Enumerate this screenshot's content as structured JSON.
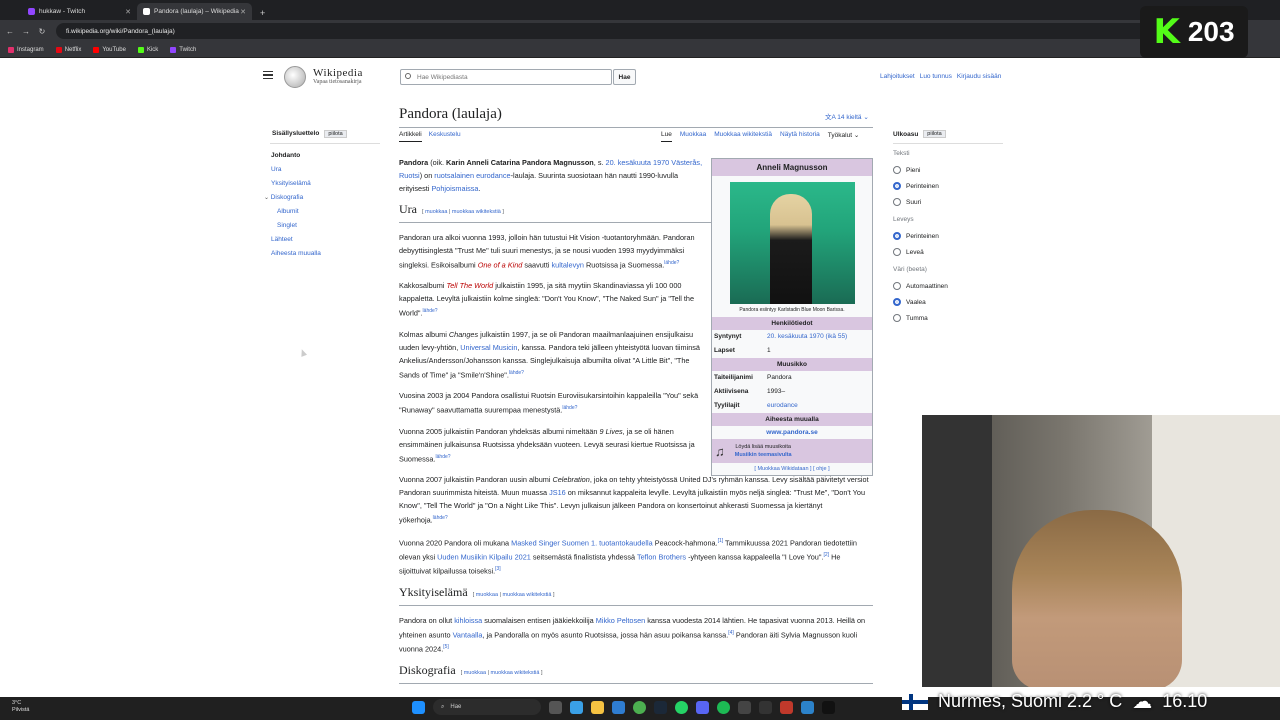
{
  "browser": {
    "tabs": [
      {
        "title": "hukkaw - Twitch",
        "active": false
      },
      {
        "title": "Pandora (laulaja) – Wikipedia",
        "active": true
      }
    ],
    "url": "fi.wikipedia.org/wiki/Pandora_(laulaja)",
    "bookmarks": [
      "Instagram",
      "Netflix",
      "YouTube",
      "Kick",
      "Twitch"
    ]
  },
  "wiki": {
    "wordmark": "Wikipedia",
    "tagline": "Vapaa tietosanakirja",
    "search_placeholder": "Hae Wikipediasta",
    "search_button": "Hae",
    "user_links": [
      "Lahjoitukset",
      "Luo tunnus",
      "Kirjaudu sisään"
    ],
    "title": "Pandora (laulaja)",
    "languages": "14 kieltä",
    "tabs_left": [
      "Artikkeli",
      "Keskustelu"
    ],
    "tabs_right": [
      "Lue",
      "Muokkaa",
      "Muokkaa wikitekstiä",
      "Näytä historia",
      "Työkalut"
    ]
  },
  "toc": {
    "title": "Sisällysluettelo",
    "hide": "piilota",
    "items": [
      {
        "label": "Johdanto",
        "level": 0,
        "selected": true
      },
      {
        "label": "Ura",
        "level": 0
      },
      {
        "label": "Yksityiselämä",
        "level": 0
      },
      {
        "label": "Diskografia",
        "level": 0
      },
      {
        "label": "Albumit",
        "level": 1
      },
      {
        "label": "Singlet",
        "level": 1
      },
      {
        "label": "Lähteet",
        "level": 0
      },
      {
        "label": "Aiheesta muualla",
        "level": 0
      }
    ]
  },
  "appearance": {
    "title": "Ulkoasu",
    "hide": "piilota",
    "text_label": "Teksti",
    "text_options": [
      {
        "label": "Pieni",
        "on": false
      },
      {
        "label": "Perinteinen",
        "on": true
      },
      {
        "label": "Suuri",
        "on": false
      }
    ],
    "width_label": "Leveys",
    "width_options": [
      {
        "label": "Perinteinen",
        "on": true
      },
      {
        "label": "Leveä",
        "on": false
      }
    ],
    "color_label": "Väri (beeta)",
    "color_options": [
      {
        "label": "Automaattinen",
        "on": false
      },
      {
        "label": "Vaalea",
        "on": true
      },
      {
        "label": "Tumma",
        "on": false
      }
    ]
  },
  "content": {
    "lead": {
      "name": "Pandora",
      "a": " (oik. ",
      "fullname": "Karin Anneli Catarina Pandora Magnusson",
      "b": ", s. ",
      "date": "20. kesäkuuta 1970",
      "place": "Västerås, Ruotsi",
      "c": ") on ",
      "genre": "ruotsalainen eurodance",
      "d": "-laulaja. Suurinta suosiotaan hän nautti 1990-luvulla erityisesti ",
      "region": "Pohjoismaissa",
      "e": "."
    },
    "edit": "muokkaa",
    "edit_wiki": "muokkaa wikitekstiä",
    "h_ura": "Ura",
    "ura_p1": "Pandoran ura alkoi vuonna 1993, jolloin hän tutustui Hit Vision -tuotantoryhmään. Pandoran debyyttisinglestä \"Trust Me\" tuli suuri menestys, ja se nousi vuoden 1993 myydyimmäksi singleksi. Esikoisalbumi ",
    "ura_p1_album": "One of a Kind",
    "ura_p1_b": " saavutti ",
    "ura_p1_link": "kultalevyn",
    "ura_p1_c": " Ruotsissa ja Suomessa.",
    "lahde": "lähde?",
    "ura_p2_a": "Kakkosalbumi ",
    "ura_p2_album": "Tell The World",
    "ura_p2_b": " julkaistiin 1995, ja sitä myytiin Skandinaviassa yli 100 000 kappaletta. Levyltä julkaistiin kolme singleä: \"Don't You Know\", \"The Naked Sun\" ja \"Tell the World\".",
    "ura_p3_a": "Kolmas albumi ",
    "ura_p3_album": "Changes",
    "ura_p3_b": " julkaistiin 1997, ja se oli Pandoran maailmanlaajuinen ensijulkaisu uuden levy-yhtiön, ",
    "ura_p3_link": "Universal Musicin",
    "ura_p3_c": ", kanssa. Pandora teki jälleen yhteistyötä luovan tiiminsä Ankelius/Andersson/Johansson kanssa. Singlejulkaisuja albumilta olivat \"A Little Bit\", \"The Sands of Time\" ja \"Smile'n'Shine\".",
    "ura_p4": "Vuosina 2003 ja 2004 Pandora osallistui Ruotsin Euroviisukarsintoihin kappaleilla \"You\" sekä \"Runaway\" saavuttamatta suurempaa menestystä.",
    "ura_p5_a": "Vuonna 2005 julkaistiin Pandoran yhdeksäs albumi nimeltään ",
    "ura_p5_album": "9 Lives",
    "ura_p5_b": ", ja se oli hänen ensimmäinen julkaisunsa Ruotsissa yhdeksään vuoteen. Levyä seurasi kiertue Ruotsissa ja Suomessa.",
    "ura_p6_a": "Vuonna 2007 julkaistiin Pandoran uusin albumi ",
    "ura_p6_album": "Celebration",
    "ura_p6_b": ", joka on tehty yhteistyössä United DJ's ryhmän kanssa. Levy sisältää päivitetyt versiot Pandoran suurimmista hiteistä. Muun muassa ",
    "ura_p6_link": "JS16",
    "ura_p6_c": " on miksannut kappaleita levylle. Levyltä julkaistiin myös neljä singleä: \"Trust Me\", \"Don't You Know\", \"Tell The World\" ja \"On a Night Like This\". Levyn julkaisun jälkeen Pandora on konsertoinut ahkerasti Suomessa ja kiertänyt yökerhoja.",
    "ura_p7_a": "Vuonna 2020 Pandora oli mukana ",
    "ura_p7_link1": "Masked Singer Suomen 1. tuotantokaudella",
    "ura_p7_b": " Peacock-hahmona.",
    "ref1": "[1]",
    "ura_p7_c": " Tammikuussa 2021 Pandoran tiedotettiin olevan yksi ",
    "ura_p7_link2": "Uuden Musiikin Kilpailu 2021",
    "ura_p7_d": " seitsemästä finalistista yhdessä ",
    "ura_p7_link3": "Teflon Brothers",
    "ura_p7_e": " -yhtyeen kanssa kappaleella \"I Love You\".",
    "ref2": "[2]",
    "ura_p7_f": " He sijoittuivat kilpailussa toiseksi.",
    "ref3": "[3]",
    "h_yks": "Yksityiselämä",
    "yks_a": "Pandora on ollut ",
    "yks_link1": "kihloissa",
    "yks_b": " suomalaisen entisen jääkiekkoilija ",
    "yks_link2": "Mikko Peltosen",
    "yks_c": " kanssa vuodesta 2014 lähtien. He tapasivat vuonna 2013. Heillä on yhteinen asunto ",
    "yks_link3": "Vantaalla",
    "yks_d": ", ja Pandoralla on myös asunto Ruotsissa, jossa hän asuu poikansa kanssa.",
    "ref4": "[4]",
    "yks_e": " Pandoran äiti Sylvia Magnusson kuoli vuonna 2024.",
    "ref5": "[5]",
    "h_disko": "Diskografia"
  },
  "infobox": {
    "title": "Anneli Magnusson",
    "caption": "Pandora esiintyy Karlstadin Blue Moon Barissa.",
    "sec_personal": "Henkilötiedot",
    "born_label": "Syntynyt",
    "born_value": "20. kesäkuuta 1970 (ikä 55)",
    "children_label": "Lapset",
    "children_value": "1",
    "sec_music": "Muusikko",
    "stage_label": "Taiteilijanimi",
    "stage_value": "Pandora",
    "active_label": "Aktiivisena",
    "active_value": "1993–",
    "genre_label": "Tyylilajit",
    "genre_value": "eurodance",
    "sec_elsewhere": "Aiheesta muualla",
    "website": "www.pandora.se",
    "music_text": "Löydä lisää muusikoita",
    "music_link": "Musiikin teemasivulta",
    "footer": "[ Muokkaa Wikidataan ] [ ohje ]"
  },
  "overlay": {
    "k_count": "203"
  },
  "taskbar": {
    "weather_temp": "3°C",
    "weather_desc": "Pilvistä",
    "search": "Hae",
    "ticker": "Nurmes, Suomi   2.2 ° C",
    "time": "16.10"
  },
  "colors": {
    "link": "#3366cc",
    "redlink": "#ba0000",
    "infobox_header": "#d9c6e0",
    "kick": "#53fc18"
  }
}
